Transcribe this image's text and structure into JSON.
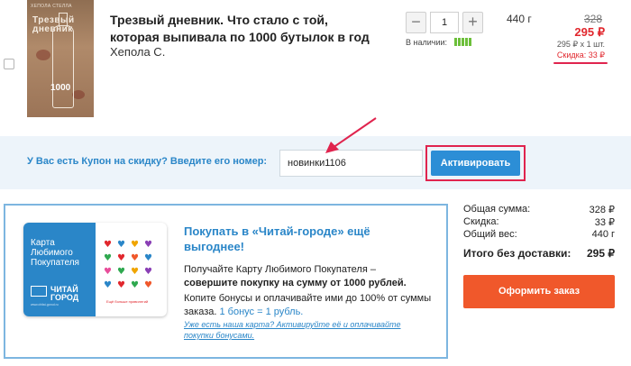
{
  "product": {
    "title": "Трезвый дневник. Что стало с той, которая выпивала по 1000 бутылок в год",
    "author": "Хепола С.",
    "quantity": "1",
    "qty_minus": "−",
    "qty_plus": "+",
    "stock_label": "В наличии:",
    "stock_level_bars": 5,
    "weight": "440 г",
    "old_price": "328",
    "new_price": "295 ₽",
    "unit_price": "295 ₽ х 1 шт.",
    "discount": "Скидка: 33 ₽",
    "cover": {
      "top_line": "ХЕПОЛА СТЕЛЛА",
      "title": "Трезвый дневник",
      "number": "1000"
    }
  },
  "coupon": {
    "label": "У Вас есть Купон на скидку? Введите его номер:",
    "input_value": "новинки1106",
    "activate_label": "Активировать"
  },
  "promo": {
    "card": {
      "name_line1": "Карта",
      "name_line2": "Любимого",
      "name_line3": "Покупателя",
      "logo_line1": "ЧИТАЙ",
      "logo_line2": "ГОРОД",
      "site": "www.chitai-gorod.ru",
      "slogan": "Ещё больше привилегий",
      "heart_colors": [
        "#e1272d",
        "#2a86c8",
        "#f0a500",
        "#8a3fb5",
        "#2fa84f",
        "#e1272d",
        "#f0582b",
        "#2a86c8",
        "#e84d9a",
        "#2fa84f",
        "#f0a500",
        "#8a3fb5",
        "#2a86c8",
        "#e1272d",
        "#2fa84f",
        "#f0582b"
      ]
    },
    "title": "Покупать в «Читай-городе» ещё выгоднее!",
    "text1_start": "Получайте Карту Любимого Покупателя – ",
    "text1_bold": "совершите покупку на сумму от 1000 рублей.",
    "text2_start": "Копите бонусы и оплачивайте ими до 100% от суммы заказа. ",
    "text2_blue": "1 бонус = 1 рубль.",
    "link": "Уже есть наша карта? Активируйте её и оплачивайте покупки бонусами."
  },
  "summary": {
    "rows": [
      {
        "label": "Общая сумма:",
        "value": "328 ₽"
      },
      {
        "label": "Скидка:",
        "value": "33 ₽"
      },
      {
        "label": "Общий вес:",
        "value": "440 г"
      }
    ],
    "total_label": "Итого без доставки:",
    "total_value": "295 ₽",
    "order_button": "Оформить заказ"
  },
  "colors": {
    "accent_blue": "#2a86c8",
    "button_blue": "#2c8ed6",
    "price_red": "#e1272d",
    "annotation_red": "#e0244e",
    "order_orange": "#f0582b",
    "stock_green": "#6cbf3a"
  }
}
